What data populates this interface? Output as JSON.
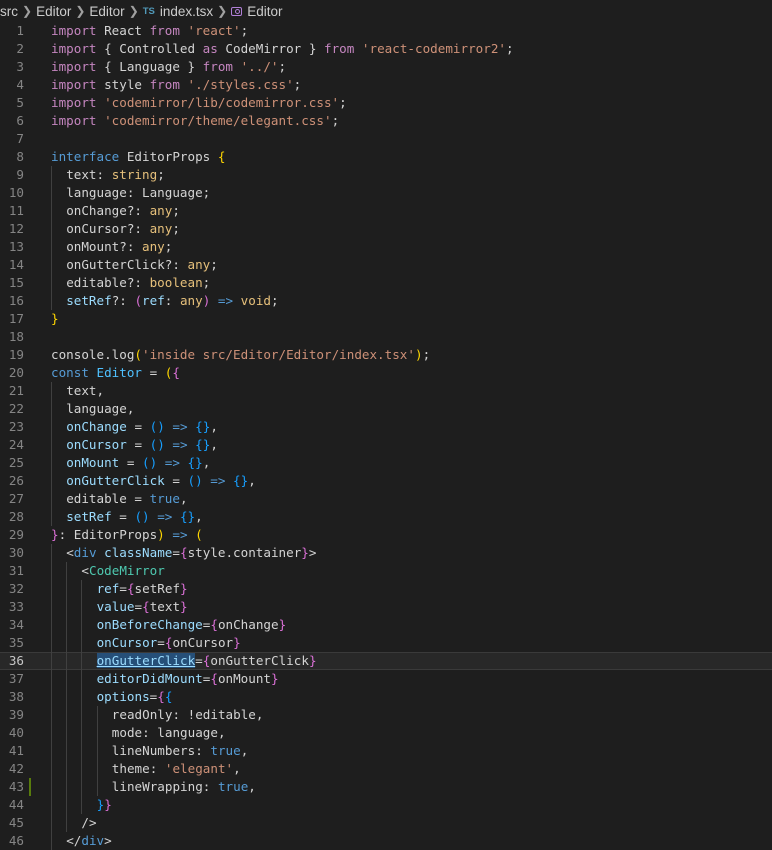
{
  "breadcrumb": {
    "items": [
      "src",
      "Editor",
      "Editor",
      "index.tsx",
      "Editor"
    ],
    "file_badge": "TS"
  },
  "colors": {
    "background": "#1e1e1e",
    "keyword": "#569cd6",
    "control": "#c586c0",
    "string": "#ce9178",
    "type": "#4ec9b0",
    "param": "#9cdcfe"
  },
  "active_line": 36,
  "lines": [
    {
      "n": "1",
      "indent": 0,
      "tokens": [
        [
          "ctl",
          "import"
        ],
        [
          "plain",
          " React "
        ],
        [
          "ctl",
          "from"
        ],
        [
          "plain",
          " "
        ],
        [
          "str",
          "'react'"
        ],
        [
          "plain",
          ";"
        ]
      ]
    },
    {
      "n": "2",
      "indent": 0,
      "tokens": [
        [
          "ctl",
          "import"
        ],
        [
          "plain",
          " { Controlled "
        ],
        [
          "ctl",
          "as"
        ],
        [
          "plain",
          " CodeMirror } "
        ],
        [
          "ctl",
          "from"
        ],
        [
          "plain",
          " "
        ],
        [
          "str",
          "'react-codemirror2'"
        ],
        [
          "plain",
          ";"
        ]
      ]
    },
    {
      "n": "3",
      "indent": 0,
      "tokens": [
        [
          "ctl",
          "import"
        ],
        [
          "plain",
          " { Language } "
        ],
        [
          "ctl",
          "from"
        ],
        [
          "plain",
          " "
        ],
        [
          "str",
          "'../'"
        ],
        [
          "plain",
          ";"
        ]
      ]
    },
    {
      "n": "4",
      "indent": 0,
      "tokens": [
        [
          "ctl",
          "import"
        ],
        [
          "plain",
          " style "
        ],
        [
          "ctl",
          "from"
        ],
        [
          "plain",
          " "
        ],
        [
          "str",
          "'./styles.css'"
        ],
        [
          "plain",
          ";"
        ]
      ]
    },
    {
      "n": "5",
      "indent": 0,
      "tokens": [
        [
          "ctl",
          "import"
        ],
        [
          "plain",
          " "
        ],
        [
          "str",
          "'codemirror/lib/codemirror.css'"
        ],
        [
          "plain",
          ";"
        ]
      ]
    },
    {
      "n": "6",
      "indent": 0,
      "tokens": [
        [
          "ctl",
          "import"
        ],
        [
          "plain",
          " "
        ],
        [
          "str",
          "'codemirror/theme/elegant.css'"
        ],
        [
          "plain",
          ";"
        ]
      ]
    },
    {
      "n": "7",
      "indent": 0,
      "tokens": []
    },
    {
      "n": "8",
      "indent": 0,
      "tokens": [
        [
          "kw",
          "interface"
        ],
        [
          "plain",
          " EditorProps "
        ],
        [
          "br1",
          "{"
        ]
      ]
    },
    {
      "n": "9",
      "indent": 1,
      "tokens": [
        [
          "plain",
          "text: "
        ],
        [
          "yel",
          "string"
        ],
        [
          "plain",
          ";"
        ]
      ]
    },
    {
      "n": "10",
      "indent": 1,
      "tokens": [
        [
          "plain",
          "language: Language;"
        ]
      ]
    },
    {
      "n": "11",
      "indent": 1,
      "tokens": [
        [
          "plain",
          "onChange?: "
        ],
        [
          "yel",
          "any"
        ],
        [
          "plain",
          ";"
        ]
      ]
    },
    {
      "n": "12",
      "indent": 1,
      "tokens": [
        [
          "plain",
          "onCursor?: "
        ],
        [
          "yel",
          "any"
        ],
        [
          "plain",
          ";"
        ]
      ]
    },
    {
      "n": "13",
      "indent": 1,
      "tokens": [
        [
          "plain",
          "onMount?: "
        ],
        [
          "yel",
          "any"
        ],
        [
          "plain",
          ";"
        ]
      ]
    },
    {
      "n": "14",
      "indent": 1,
      "tokens": [
        [
          "plain",
          "onGutterClick?: "
        ],
        [
          "yel",
          "any"
        ],
        [
          "plain",
          ";"
        ]
      ]
    },
    {
      "n": "15",
      "indent": 1,
      "tokens": [
        [
          "plain",
          "editable?: "
        ],
        [
          "yel",
          "boolean"
        ],
        [
          "plain",
          ";"
        ]
      ]
    },
    {
      "n": "16",
      "indent": 1,
      "tokens": [
        [
          "prm",
          "setRef"
        ],
        [
          "plain",
          "?: "
        ],
        [
          "br2",
          "("
        ],
        [
          "prm",
          "ref"
        ],
        [
          "plain",
          ": "
        ],
        [
          "yel",
          "any"
        ],
        [
          "br2",
          ")"
        ],
        [
          "plain",
          " "
        ],
        [
          "kw",
          "=>"
        ],
        [
          "plain",
          " "
        ],
        [
          "yel",
          "void"
        ],
        [
          "plain",
          ";"
        ]
      ]
    },
    {
      "n": "17",
      "indent": 0,
      "tokens": [
        [
          "br1",
          "}"
        ]
      ]
    },
    {
      "n": "18",
      "indent": 0,
      "tokens": []
    },
    {
      "n": "19",
      "indent": 0,
      "tokens": [
        [
          "plain",
          "console."
        ],
        [
          "plain",
          "log"
        ],
        [
          "br1",
          "("
        ],
        [
          "str",
          "'inside src/Editor/Editor/index.tsx'"
        ],
        [
          "br1",
          ")"
        ],
        [
          "plain",
          ";"
        ]
      ]
    },
    {
      "n": "20",
      "indent": 0,
      "tokens": [
        [
          "kw",
          "const"
        ],
        [
          "plain",
          " "
        ],
        [
          "var",
          "Editor"
        ],
        [
          "plain",
          " = "
        ],
        [
          "br1",
          "("
        ],
        [
          "br2",
          "{"
        ]
      ]
    },
    {
      "n": "21",
      "indent": 1,
      "tokens": [
        [
          "plain",
          "text,"
        ]
      ]
    },
    {
      "n": "22",
      "indent": 1,
      "tokens": [
        [
          "plain",
          "language,"
        ]
      ]
    },
    {
      "n": "23",
      "indent": 1,
      "tokens": [
        [
          "prm",
          "onChange"
        ],
        [
          "plain",
          " = "
        ],
        [
          "br3",
          "()"
        ],
        [
          "plain",
          " "
        ],
        [
          "kw",
          "=>"
        ],
        [
          "plain",
          " "
        ],
        [
          "br3",
          "{}"
        ],
        [
          "plain",
          ","
        ]
      ]
    },
    {
      "n": "24",
      "indent": 1,
      "tokens": [
        [
          "prm",
          "onCursor"
        ],
        [
          "plain",
          " = "
        ],
        [
          "br3",
          "()"
        ],
        [
          "plain",
          " "
        ],
        [
          "kw",
          "=>"
        ],
        [
          "plain",
          " "
        ],
        [
          "br3",
          "{}"
        ],
        [
          "plain",
          ","
        ]
      ]
    },
    {
      "n": "25",
      "indent": 1,
      "tokens": [
        [
          "prm",
          "onMount"
        ],
        [
          "plain",
          " = "
        ],
        [
          "br3",
          "()"
        ],
        [
          "plain",
          " "
        ],
        [
          "kw",
          "=>"
        ],
        [
          "plain",
          " "
        ],
        [
          "br3",
          "{}"
        ],
        [
          "plain",
          ","
        ]
      ]
    },
    {
      "n": "26",
      "indent": 1,
      "tokens": [
        [
          "prm",
          "onGutterClick"
        ],
        [
          "plain",
          " = "
        ],
        [
          "br3",
          "()"
        ],
        [
          "plain",
          " "
        ],
        [
          "kw",
          "=>"
        ],
        [
          "plain",
          " "
        ],
        [
          "br3",
          "{}"
        ],
        [
          "plain",
          ","
        ]
      ]
    },
    {
      "n": "27",
      "indent": 1,
      "tokens": [
        [
          "plain",
          "editable = "
        ],
        [
          "kw",
          "true"
        ],
        [
          "plain",
          ","
        ]
      ]
    },
    {
      "n": "28",
      "indent": 1,
      "tokens": [
        [
          "prm",
          "setRef"
        ],
        [
          "plain",
          " = "
        ],
        [
          "br3",
          "()"
        ],
        [
          "plain",
          " "
        ],
        [
          "kw",
          "=>"
        ],
        [
          "plain",
          " "
        ],
        [
          "br3",
          "{}"
        ],
        [
          "plain",
          ","
        ]
      ]
    },
    {
      "n": "29",
      "indent": 0,
      "tokens": [
        [
          "br2",
          "}"
        ],
        [
          "plain",
          ": EditorProps"
        ],
        [
          "br1",
          ")"
        ],
        [
          "plain",
          " "
        ],
        [
          "kw",
          "=>"
        ],
        [
          "plain",
          " "
        ],
        [
          "br1",
          "("
        ]
      ]
    },
    {
      "n": "30",
      "indent": 1,
      "tokens": [
        [
          "plain",
          "<"
        ],
        [
          "tag",
          "div"
        ],
        [
          "plain",
          " "
        ],
        [
          "attr",
          "className"
        ],
        [
          "plain",
          "="
        ],
        [
          "br2",
          "{"
        ],
        [
          "plain",
          "style.container"
        ],
        [
          "br2",
          "}"
        ],
        [
          "plain",
          ">"
        ]
      ]
    },
    {
      "n": "31",
      "indent": 2,
      "tokens": [
        [
          "plain",
          "<"
        ],
        [
          "comp",
          "CodeMirror"
        ]
      ]
    },
    {
      "n": "32",
      "indent": 3,
      "tokens": [
        [
          "attr",
          "ref"
        ],
        [
          "plain",
          "="
        ],
        [
          "br2",
          "{"
        ],
        [
          "plain",
          "setRef"
        ],
        [
          "br2",
          "}"
        ]
      ]
    },
    {
      "n": "33",
      "indent": 3,
      "tokens": [
        [
          "attr",
          "value"
        ],
        [
          "plain",
          "="
        ],
        [
          "br2",
          "{"
        ],
        [
          "plain",
          "text"
        ],
        [
          "br2",
          "}"
        ]
      ]
    },
    {
      "n": "34",
      "indent": 3,
      "tokens": [
        [
          "attr",
          "onBeforeChange"
        ],
        [
          "plain",
          "="
        ],
        [
          "br2",
          "{"
        ],
        [
          "plain",
          "onChange"
        ],
        [
          "br2",
          "}"
        ]
      ]
    },
    {
      "n": "35",
      "indent": 3,
      "tokens": [
        [
          "attr",
          "onCursor"
        ],
        [
          "plain",
          "="
        ],
        [
          "br2",
          "{"
        ],
        [
          "plain",
          "onCursor"
        ],
        [
          "br2",
          "}"
        ]
      ]
    },
    {
      "n": "36",
      "indent": 3,
      "tokens": [
        [
          "attr",
          "onGutterClick"
        ],
        [
          "plain",
          "="
        ],
        [
          "br2",
          "{"
        ],
        [
          "plain",
          "onGutterClick"
        ],
        [
          "br2",
          "}"
        ]
      ]
    },
    {
      "n": "37",
      "indent": 3,
      "tokens": [
        [
          "attr",
          "editorDidMount"
        ],
        [
          "plain",
          "="
        ],
        [
          "br2",
          "{"
        ],
        [
          "plain",
          "onMount"
        ],
        [
          "br2",
          "}"
        ]
      ]
    },
    {
      "n": "38",
      "indent": 3,
      "tokens": [
        [
          "attr",
          "options"
        ],
        [
          "plain",
          "="
        ],
        [
          "br2",
          "{"
        ],
        [
          "br3",
          "{"
        ]
      ]
    },
    {
      "n": "39",
      "indent": 4,
      "tokens": [
        [
          "plain",
          "readOnly: !editable,"
        ]
      ]
    },
    {
      "n": "40",
      "indent": 4,
      "tokens": [
        [
          "plain",
          "mode: language,"
        ]
      ]
    },
    {
      "n": "41",
      "indent": 4,
      "tokens": [
        [
          "plain",
          "lineNumbers: "
        ],
        [
          "kw",
          "true"
        ],
        [
          "plain",
          ","
        ]
      ]
    },
    {
      "n": "42",
      "indent": 4,
      "tokens": [
        [
          "plain",
          "theme: "
        ],
        [
          "str",
          "'elegant'"
        ],
        [
          "plain",
          ","
        ]
      ]
    },
    {
      "n": "43",
      "indent": 4,
      "tokens": [
        [
          "plain",
          "lineWrapping: "
        ],
        [
          "kw",
          "true"
        ],
        [
          "plain",
          ","
        ]
      ]
    },
    {
      "n": "44",
      "indent": 3,
      "tokens": [
        [
          "br3",
          "}"
        ],
        [
          "br2",
          "}"
        ]
      ]
    },
    {
      "n": "45",
      "indent": 2,
      "tokens": [
        [
          "plain",
          "/>"
        ]
      ]
    },
    {
      "n": "46",
      "indent": 1,
      "tokens": [
        [
          "plain",
          "</"
        ],
        [
          "tag",
          "div"
        ],
        [
          "plain",
          ">"
        ]
      ]
    }
  ]
}
